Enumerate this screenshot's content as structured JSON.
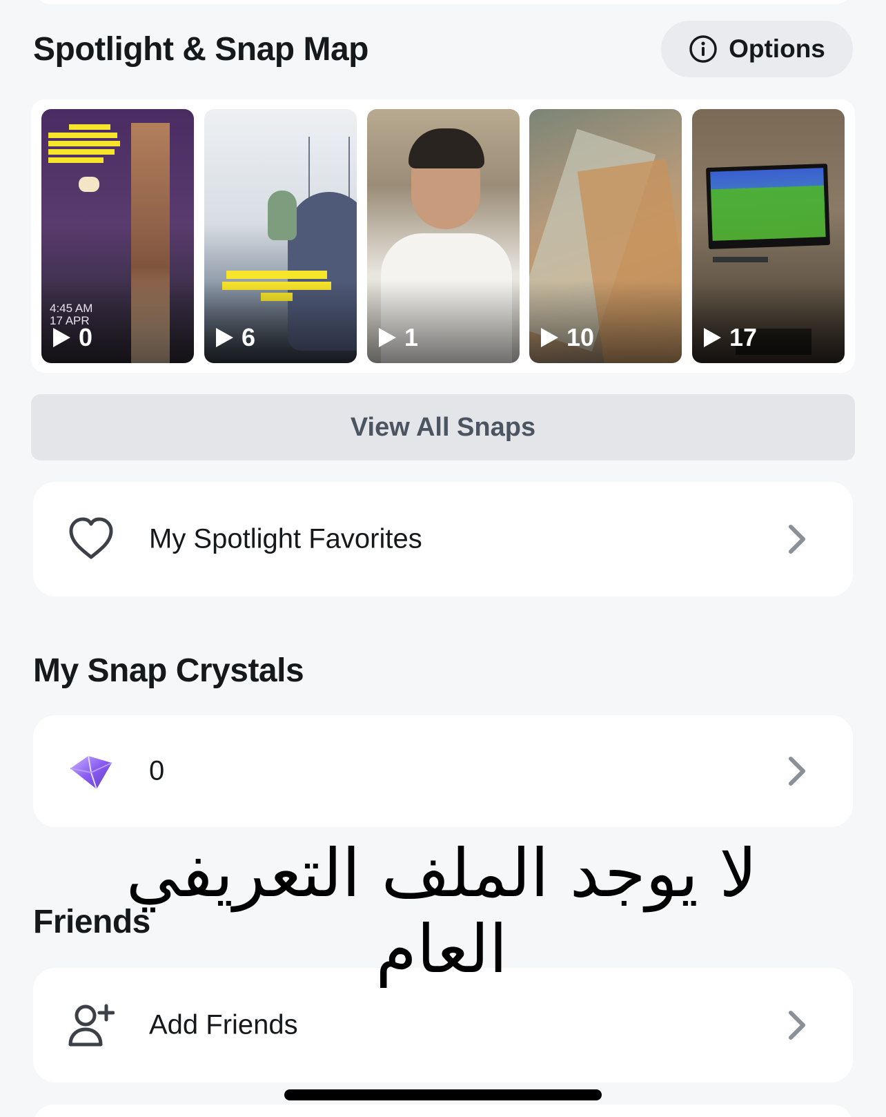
{
  "sections": {
    "spotlight_title": "Spotlight & Snap Map",
    "crystals_title": "My Snap Crystals",
    "friends_title": "Friends"
  },
  "options": {
    "label": "Options",
    "icon": "info-icon"
  },
  "snaps": [
    {
      "views": "0",
      "timestamp": "4:45 AM",
      "date": "17 APR"
    },
    {
      "views": "6"
    },
    {
      "views": "1"
    },
    {
      "views": "10"
    },
    {
      "views": "17"
    }
  ],
  "view_all": {
    "label": "View All Snaps"
  },
  "favorites": {
    "label": "My Spotlight Favorites",
    "icon": "heart-icon"
  },
  "crystals": {
    "value": "0",
    "icon": "crystal-icon"
  },
  "friends": {
    "add_label": "Add Friends",
    "icon": "add-friend-icon"
  },
  "overlay": {
    "text": "لا يوجد الملف التعريفي العام"
  },
  "colors": {
    "background": "#f6f7f8",
    "card": "#ffffff",
    "button_gray": "#e3e5e8",
    "text": "#16191c"
  }
}
